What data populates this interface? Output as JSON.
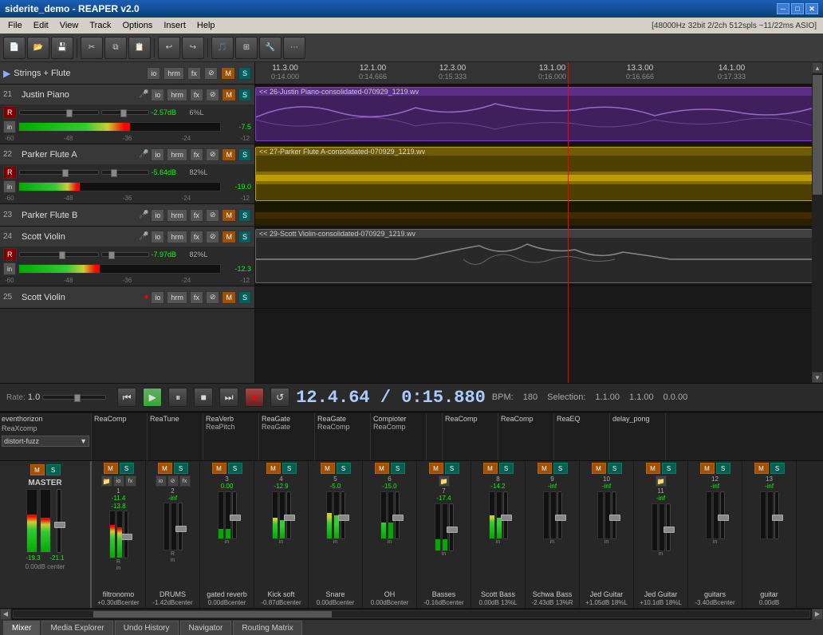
{
  "titlebar": {
    "title": "siderite_demo - REAPER v2.0"
  },
  "menubar": {
    "items": [
      "File",
      "Edit",
      "View",
      "Track",
      "Options",
      "Insert",
      "Help"
    ],
    "status": "[48000Hz 32bit 2/2ch 512spls ~11/22ms ASIO]"
  },
  "transport": {
    "time": "12.4.64 / 0:15.880",
    "bpm_label": "BPM:",
    "bpm_value": "180",
    "selection_label": "Selection:",
    "sel_start": "1.1.00",
    "sel_end": "1.1.00",
    "sel_len": "0.0.00",
    "rate_label": "Rate:",
    "rate_value": "1.0"
  },
  "tracks": [
    {
      "num": "21",
      "name": "Justin Piano",
      "vol": "-2.57dB",
      "pan": "6%L",
      "vu_val": "-7.5",
      "clip_label": "<< 26-Justin Piano-consolidated-070929_1219.wv",
      "type": "purple"
    },
    {
      "num": "22",
      "name": "Parker Flute A",
      "vol": "-5.64dB",
      "pan": "82%L",
      "vu_val": "-19.0",
      "clip_label": "<< 27-Parker Flute A-consolidated-070929_1219.wv",
      "type": "yellow"
    },
    {
      "num": "23",
      "name": "Parker Flute B",
      "vol": "",
      "pan": "",
      "vu_val": "",
      "clip_label": "",
      "type": "yellow"
    },
    {
      "num": "24",
      "name": "Scott Violin",
      "vol": "-7.97dB",
      "pan": "82%L",
      "vu_val": "-12.3",
      "clip_label": "<< 29-Scott Violin-consolidated-070929_1219.wv",
      "type": "gray"
    }
  ],
  "group_header": {
    "name": "Strings + Flute"
  },
  "track25": {
    "num": "25",
    "name": "Scott Violin"
  },
  "timeline": {
    "markers": [
      {
        "bar": "11.3.00",
        "time": "0:14.000"
      },
      {
        "bar": "12.1.00",
        "time": "0:14.666"
      },
      {
        "bar": "12.3.00",
        "time": "0:15.333"
      },
      {
        "bar": "13.1.00",
        "time": "0:16.000"
      },
      {
        "bar": "13.3.00",
        "time": "0:16.666"
      },
      {
        "bar": "14.1.00",
        "time": "0:17.333"
      }
    ]
  },
  "fx_plugins": {
    "eventhorizon": "eventhorizon",
    "reaxcomp": "ReaXcomp",
    "channels": [
      {
        "name1": "ReaComp",
        "name2": ""
      },
      {
        "name1": "ReaTune",
        "name2": ""
      },
      {
        "name1": "ReaVerb",
        "name2": "ReaPitch"
      },
      {
        "name1": "ReaGate",
        "name2": "ReaGate"
      },
      {
        "name1": "ReaGate",
        "name2": "ReaComp"
      },
      {
        "name1": "Compioter",
        "name2": "ReaComp"
      },
      {
        "name1": "",
        "name2": ""
      },
      {
        "name1": "ReaComp",
        "name2": ""
      },
      {
        "name1": "ReaComp",
        "name2": ""
      },
      {
        "name1": "ReaEQ",
        "name2": ""
      },
      {
        "name1": "delay_pong",
        "name2": ""
      }
    ],
    "fx_dropdown": "distort-fuzz"
  },
  "mixer_channels": [
    {
      "num": "1",
      "name": "filtronomo",
      "db": "-11.4",
      "db2": "-13.8",
      "level": "",
      "pan_db": "+0.30dBcenter"
    },
    {
      "num": "2",
      "name": "DRUMS",
      "db": "-inf",
      "db2": "",
      "level": "",
      "pan_db": "-1.42dBcenter"
    },
    {
      "num": "3",
      "name": "gated reverb",
      "db": "0.00",
      "db2": "",
      "level": "",
      "pan_db": "0.00dBcenter"
    },
    {
      "num": "4",
      "name": "Kick soft",
      "db": "-12.9",
      "db2": "",
      "level": "",
      "pan_db": "-0.87dBcenter"
    },
    {
      "num": "5",
      "name": "Snare",
      "db": "-5.0",
      "db2": "",
      "level": "",
      "pan_db": "0.00dBcenter"
    },
    {
      "num": "6",
      "name": "OH",
      "db": "-15.0",
      "db2": "",
      "level": "",
      "pan_db": "0.00dBcenter"
    },
    {
      "num": "7",
      "name": "Basses",
      "db": "-17.4",
      "db2": "",
      "level": "",
      "pan_db": "-0.16dBcenter"
    },
    {
      "num": "8",
      "name": "Scott Bass",
      "db": "-14.2",
      "db2": "",
      "level": "",
      "pan_db": "0.00dB 13%L"
    },
    {
      "num": "9",
      "name": "Schwa Bass",
      "db": "-inf",
      "db2": "",
      "level": "",
      "pan_db": "-2.43dB 13%R"
    },
    {
      "num": "10",
      "name": "Jed Guitar",
      "db": "-inf",
      "db2": "",
      "level": "",
      "pan_db": "+1.05dB 18%L"
    },
    {
      "num": "11",
      "name": "Jed Guitar",
      "db": "-inf",
      "db2": "",
      "level": "",
      "pan_db": "+10.1dB 18%L"
    },
    {
      "num": "12",
      "name": "guitars",
      "db": "-inf",
      "db2": "",
      "level": "",
      "pan_db": "-3.40dBcenter"
    },
    {
      "num": "13",
      "name": "guitar",
      "db": "-inf",
      "db2": "",
      "level": "",
      "pan_db": "0.00dB"
    }
  ],
  "master": {
    "label": "MASTER",
    "db1": "-19.3",
    "db2": "-21.1",
    "level": "0.00dB center"
  },
  "bottom_tabs": [
    {
      "label": "Mixer",
      "active": true
    },
    {
      "label": "Media Explorer",
      "active": false
    },
    {
      "label": "Undo History",
      "active": false
    },
    {
      "label": "Navigator",
      "active": false
    },
    {
      "label": "Routing Matrix",
      "active": false
    }
  ]
}
